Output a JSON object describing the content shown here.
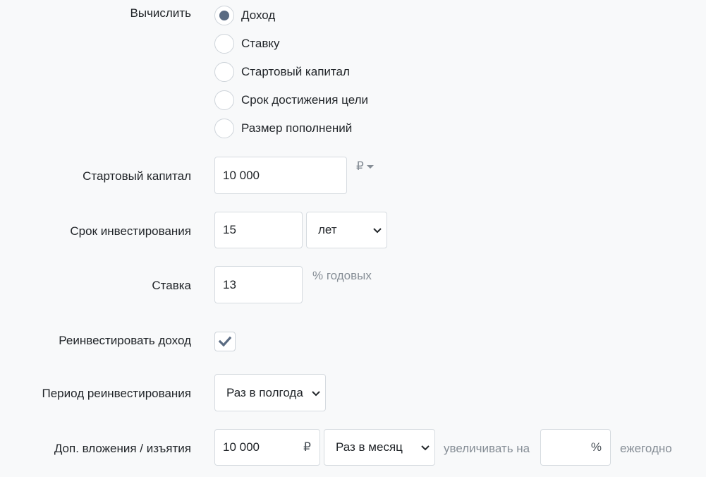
{
  "calculate": {
    "label": "Вычислить",
    "options": [
      {
        "label": "Доход",
        "checked": true
      },
      {
        "label": "Ставку",
        "checked": false
      },
      {
        "label": "Стартовый капитал",
        "checked": false
      },
      {
        "label": "Срок достижения цели",
        "checked": false
      },
      {
        "label": "Размер пополнений",
        "checked": false
      }
    ]
  },
  "start_capital": {
    "label": "Стартовый капитал",
    "value": "10 000",
    "currency": "₽"
  },
  "term": {
    "label": "Срок инвестирования",
    "value": "15",
    "unit": "лет"
  },
  "rate": {
    "label": "Ставка",
    "value": "13",
    "suffix": "% годовых"
  },
  "reinvest": {
    "label": "Реинвестировать доход",
    "checked": true
  },
  "reinvest_period": {
    "label": "Период реинвестирования",
    "value": "Раз в полгода"
  },
  "contributions": {
    "label": "Доп. вложения / изъятия",
    "value": "10 000",
    "currency": "₽",
    "frequency": "Раз в месяц",
    "increase_label": "увеличивать на",
    "increase_value": "",
    "increase_unit": "%",
    "annually_label": "ежегодно"
  },
  "colors": {
    "radio_dot": "#5a6b82",
    "border": "#d6dbe0",
    "muted_text": "#868e96"
  }
}
